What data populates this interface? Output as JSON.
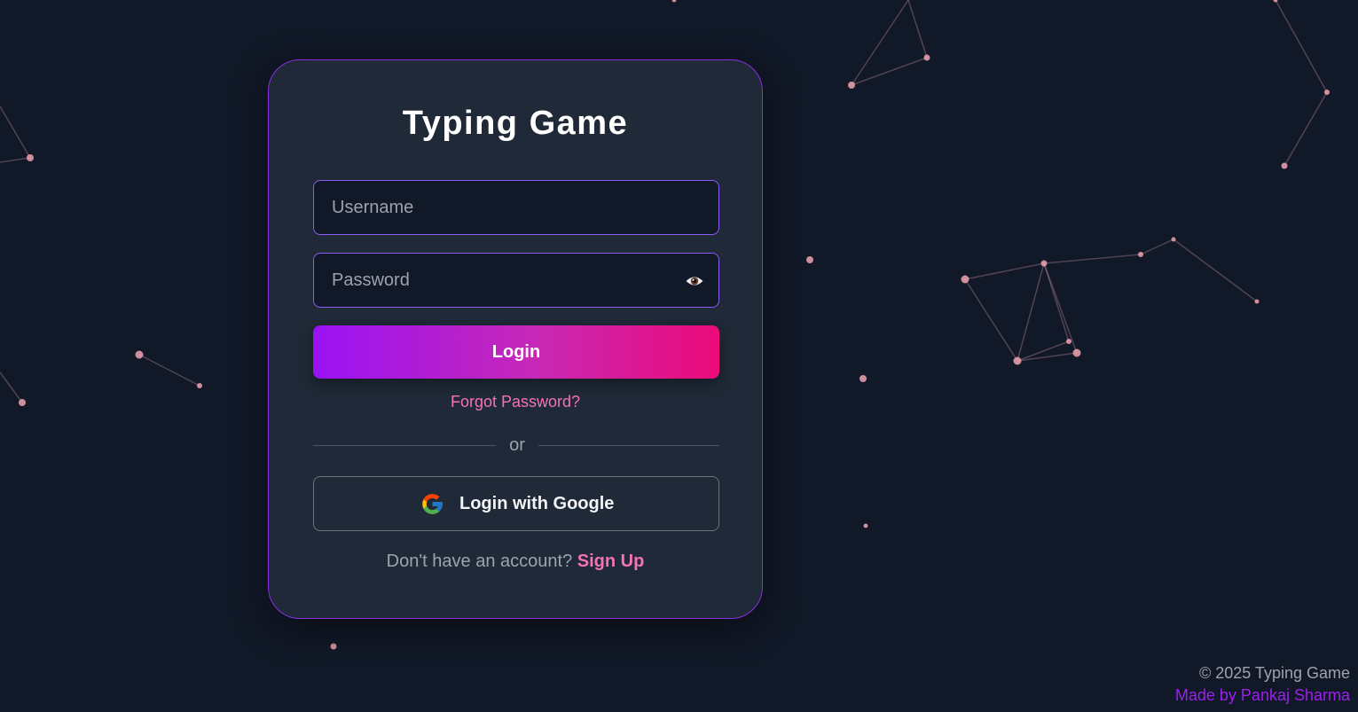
{
  "login_card": {
    "title": "Typing Game",
    "username_placeholder": "Username",
    "password_placeholder": "Password",
    "login_label": "Login",
    "forgot_label": "Forgot Password?",
    "divider_text": "or",
    "google_label": "Login with Google",
    "signup_prompt": "Don't have an account?",
    "signup_label": "Sign Up"
  },
  "footer": {
    "copyright": "© 2025 Typing Game",
    "made_by": "Made by Pankaj Sharma"
  },
  "icons": {
    "password_toggle": "eye-icon",
    "google": "google-logo-icon"
  },
  "colors": {
    "background": "#111827",
    "card": "#1f2937",
    "card_border": "#8b2fe0",
    "accent_pink": "#f472b6",
    "accent_purple": "#9d1ff0",
    "gradient_start": "#9a12f5",
    "gradient_end": "#ec0b78",
    "particle": "#f0a3b0"
  }
}
